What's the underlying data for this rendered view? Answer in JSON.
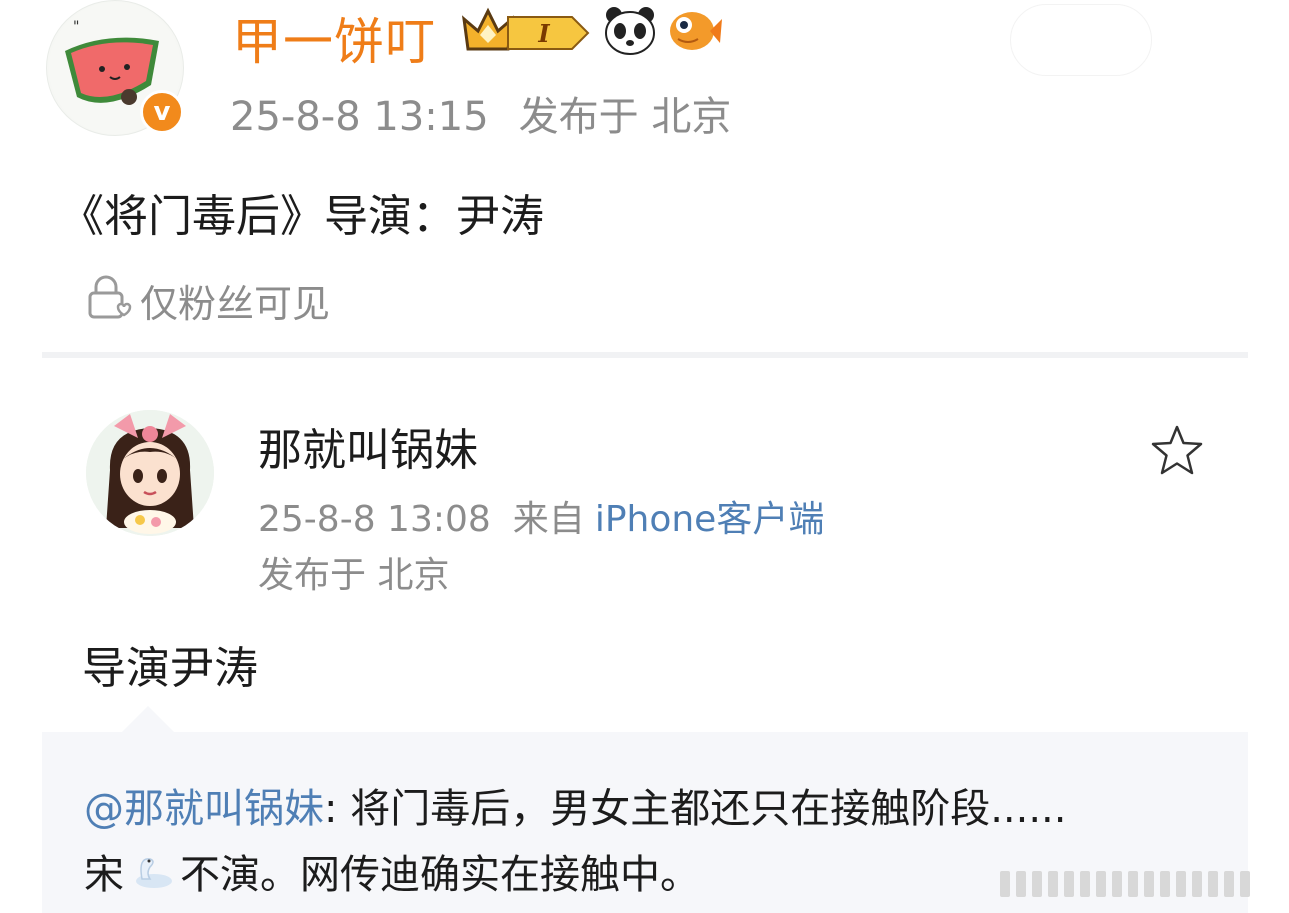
{
  "post": {
    "username": "甲一饼叮",
    "level_badge": "I",
    "timestamp": "25-8-8 13:15",
    "location": "发布于 北京",
    "text": "《将门毒后》导演：尹涛",
    "visibility": "仅粉丝可见",
    "verified_mark": "v"
  },
  "repost": {
    "username": "那就叫锅妹",
    "timestamp": "25-8-8 13:08",
    "source_prefix": "来自",
    "source": "iPhone客户端",
    "location": "发布于 北京",
    "text": "导演尹涛"
  },
  "quoted": {
    "mention": "@那就叫锅妹",
    "line1_rest": ": 将门毒后，男女主都还只在接触阶段......",
    "line2_before": "宋",
    "line2_after": "不演。网传迪确实在接触中。"
  },
  "colors": {
    "username_orange": "#ef7d18",
    "link_blue": "#4f7fb5",
    "meta_gray": "#8c8c8c",
    "quote_bg": "#f6f7fa"
  },
  "icons": [
    "watermelon-avatar",
    "verified-icon",
    "crown-badge-icon",
    "panda-icon",
    "fish-icon",
    "lock-heart-icon",
    "girl-avatar",
    "star-icon",
    "swan-emoji"
  ]
}
